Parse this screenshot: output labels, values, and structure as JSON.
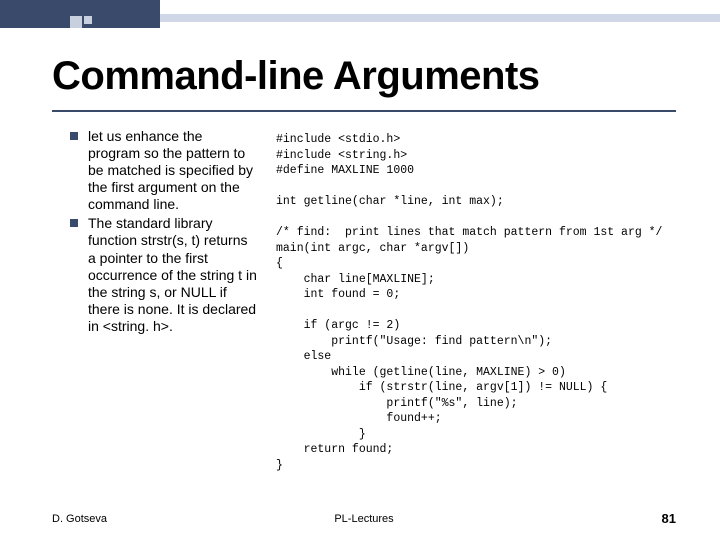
{
  "slide": {
    "title": "Command-line Arguments",
    "bullets": [
      "let us enhance the program so the pattern to be matched is specified by the first argument on the command line.",
      "The standard library function strstr(s, t) returns a pointer to the first occurrence of the string t in the string s, or NULL if there is none. It is declared in <string. h>."
    ],
    "code": "#include <stdio.h>\n#include <string.h>\n#define MAXLINE 1000\n\nint getline(char *line, int max);\n\n/* find:  print lines that match pattern from 1st arg */\nmain(int argc, char *argv[])\n{\n    char line[MAXLINE];\n    int found = 0;\n\n    if (argc != 2)\n        printf(\"Usage: find pattern\\n\");\n    else\n        while (getline(line, MAXLINE) > 0)\n            if (strstr(line, argv[1]) != NULL) {\n                printf(\"%s\", line);\n                found++;\n            }\n    return found;\n}"
  },
  "footer": {
    "author": "D. Gotseva",
    "center": "PL-Lectures",
    "page": "81"
  }
}
